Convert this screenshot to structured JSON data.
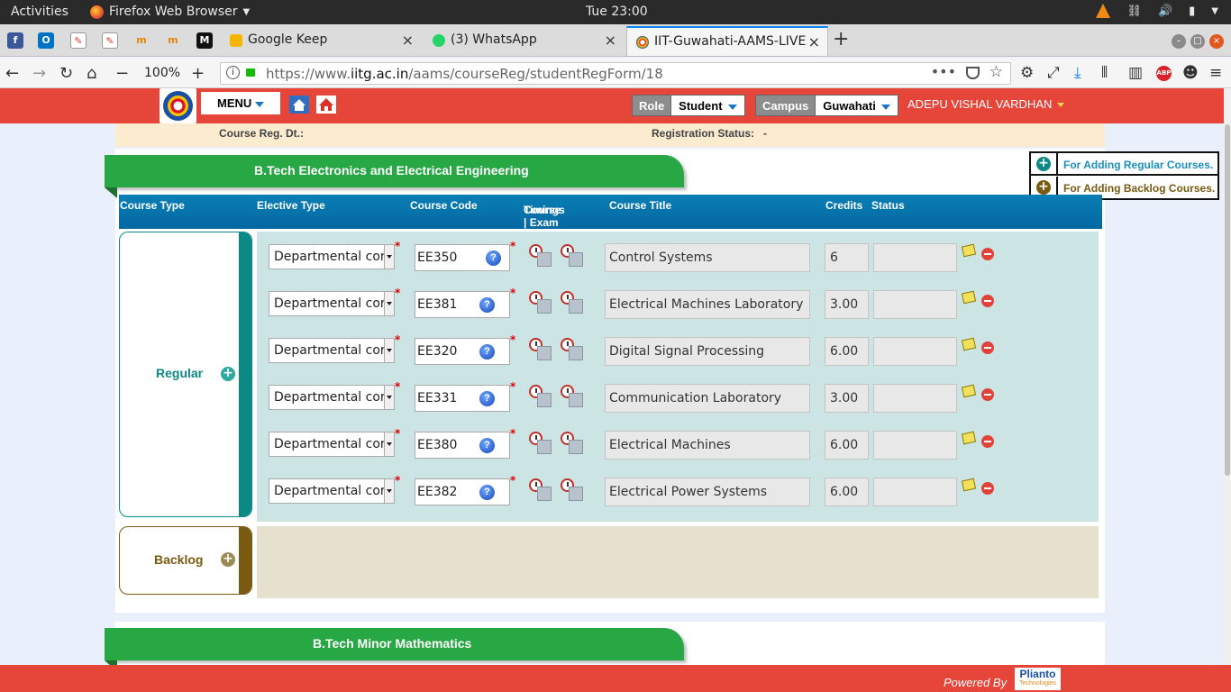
{
  "gnome": {
    "activities": "Activities",
    "app_name": "Firefox Web Browser",
    "clock": "Tue 23:00"
  },
  "tabs": [
    {
      "title": "Google Keep",
      "icon": "google-keep-icon",
      "color": "#f7b500"
    },
    {
      "title": "(3) WhatsApp",
      "icon": "whatsapp-icon",
      "color": "#25d366"
    },
    {
      "title": "IIT-Guwahati-AAMS-LIVE",
      "icon": "iitg-icon",
      "active": true
    }
  ],
  "pinned_tabs": [
    "facebook-icon",
    "outlook-icon",
    "edit-icon",
    "edit-icon",
    "moodle-icon",
    "moodle-icon",
    "medium-icon"
  ],
  "navbar": {
    "zoom": "100%",
    "url_prefix": "https://www.",
    "url_domain": "iitg.ac.in",
    "url_path": "/aams/courseReg/studentRegForm/18"
  },
  "header": {
    "menu_label": "MENU",
    "role_label": "Role",
    "role_value": "Student",
    "campus_label": "Campus",
    "campus_value": "Guwahati",
    "user_name": "ADEPU VISHAL VARDHAN"
  },
  "info": {
    "reg_date_label": "Course Reg. Dt.:",
    "reg_status_label": "Registration Status:",
    "reg_status_value": "-"
  },
  "program": {
    "title": "B.Tech Electronics and Electrical Engineering",
    "minor_title": "B.Tech Minor Mathematics"
  },
  "add_panel": {
    "regular": "For Adding Regular Courses.",
    "backlog": "For Adding Backlog Courses."
  },
  "columns": {
    "course_type": "Course Type",
    "elective_type": "Elective Type",
    "course_code": "Course Code",
    "timings_1": "Course | Exam",
    "timings_2": "Timings",
    "course_title": "Course Title",
    "credits": "Credits",
    "status": "Status"
  },
  "sections": {
    "regular": "Regular",
    "backlog": "Backlog"
  },
  "courses": [
    {
      "elective": "Departmental core",
      "code": "EE350",
      "title": "Control Systems",
      "credits": "6",
      "status": ""
    },
    {
      "elective": "Departmental core",
      "code": "EE381",
      "title": "Electrical Machines Laboratory",
      "credits": "3.00",
      "status": ""
    },
    {
      "elective": "Departmental core",
      "code": "EE320",
      "title": "Digital Signal Processing",
      "credits": "6.00",
      "status": ""
    },
    {
      "elective": "Departmental core",
      "code": "EE331",
      "title": "Communication Laboratory",
      "credits": "3.00",
      "status": ""
    },
    {
      "elective": "Departmental core",
      "code": "EE380",
      "title": "Electrical Machines",
      "credits": "6.00",
      "status": ""
    },
    {
      "elective": "Departmental core",
      "code": "EE382",
      "title": "Electrical Power Systems",
      "credits": "6.00",
      "status": ""
    }
  ],
  "footer": {
    "powered_by": "Powered By",
    "brand": "Plianto",
    "brand_sub": "Technologies"
  },
  "colors": {
    "header_red": "#e6463a",
    "banner_green": "#28a745",
    "teal": "#0b8a85",
    "olive": "#7a5a10",
    "table_blue": "#0a7fb5"
  }
}
